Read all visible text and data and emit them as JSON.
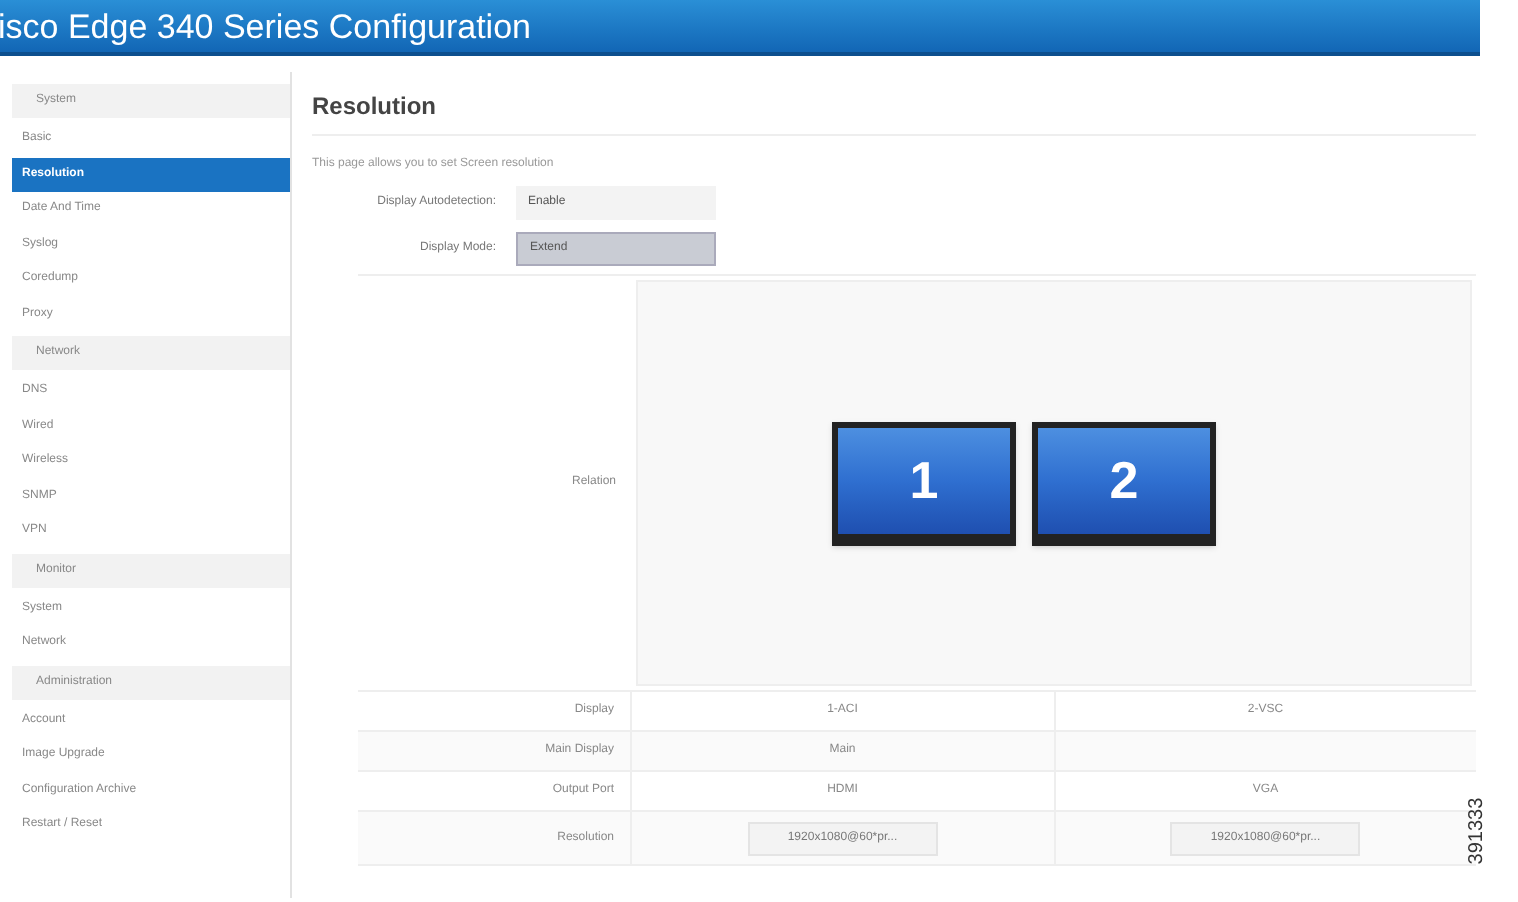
{
  "header": {
    "title": "isco Edge 340 Series Configuration"
  },
  "sidebar": {
    "groups": [
      {
        "heading": "System",
        "items": [
          {
            "label": "Basic",
            "selected": false
          },
          {
            "label": "Resolution",
            "selected": true
          },
          {
            "label": "Date And Time",
            "selected": false
          },
          {
            "label": "Syslog",
            "selected": false
          },
          {
            "label": "Coredump",
            "selected": false
          },
          {
            "label": "Proxy",
            "selected": false
          }
        ]
      },
      {
        "heading": "Network",
        "items": [
          {
            "label": "DNS",
            "selected": false
          },
          {
            "label": "Wired",
            "selected": false
          },
          {
            "label": "Wireless",
            "selected": false
          },
          {
            "label": "SNMP",
            "selected": false
          },
          {
            "label": "VPN",
            "selected": false
          }
        ]
      },
      {
        "heading": "Monitor",
        "items": [
          {
            "label": "System",
            "selected": false
          },
          {
            "label": "Network",
            "selected": false
          }
        ]
      },
      {
        "heading": "Administration",
        "items": [
          {
            "label": "Account",
            "selected": false
          },
          {
            "label": "Image Upgrade",
            "selected": false
          },
          {
            "label": "Configuration Archive",
            "selected": false
          },
          {
            "label": "Restart / Reset",
            "selected": false
          }
        ]
      }
    ]
  },
  "main": {
    "title": "Resolution",
    "description": "This page allows you to set Screen resolution",
    "fields": [
      {
        "label": "Display Autodetection:",
        "value": "Enable",
        "selected": false
      },
      {
        "label": "Display Mode:",
        "value": "Extend",
        "selected": true
      }
    ],
    "relation": {
      "label": "Relation",
      "monitors": [
        "1",
        "2"
      ]
    },
    "table": {
      "rows": [
        {
          "kind": "text",
          "label": "Display",
          "cells": [
            "1-ACI",
            "2-VSC"
          ]
        },
        {
          "kind": "text",
          "label": "Main Display",
          "cells": [
            "Main",
            ""
          ]
        },
        {
          "kind": "text",
          "label": "Output Port",
          "cells": [
            "HDMI",
            "VGA"
          ]
        },
        {
          "kind": "select",
          "label": "Resolution",
          "cells": [
            "1920x1080@60*pr...",
            "1920x1080@60*pr..."
          ]
        }
      ]
    }
  },
  "figure_id": "391333"
}
